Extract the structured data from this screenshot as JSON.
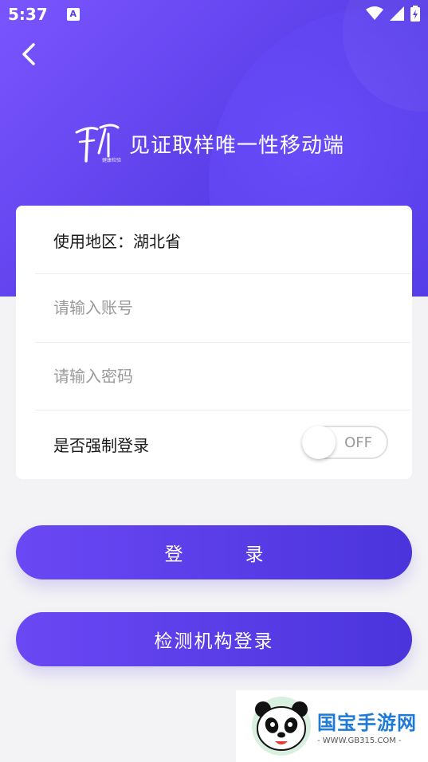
{
  "status_bar": {
    "time": "5:37",
    "notification_icon": "A"
  },
  "header": {
    "back_icon": "chevron-left-icon",
    "logo_small_text": "健康检验",
    "app_title": "见证取样唯一性移动端"
  },
  "form": {
    "region_label": "使用地区：湖北省",
    "account_placeholder": "请输入账号",
    "account_value": "",
    "password_placeholder": "请输入密码",
    "password_value": "",
    "force_login_label": "是否强制登录",
    "force_login_state": "OFF"
  },
  "buttons": {
    "login_label": "登录",
    "agency_login_label": "检测机构登录"
  },
  "watermark": {
    "title": "国宝手游网",
    "url": "- WWW.GB315.COM -"
  },
  "colors": {
    "accent": "#5b3fe8",
    "accent_light": "#7a55ff",
    "background": "#f3f3f5"
  }
}
